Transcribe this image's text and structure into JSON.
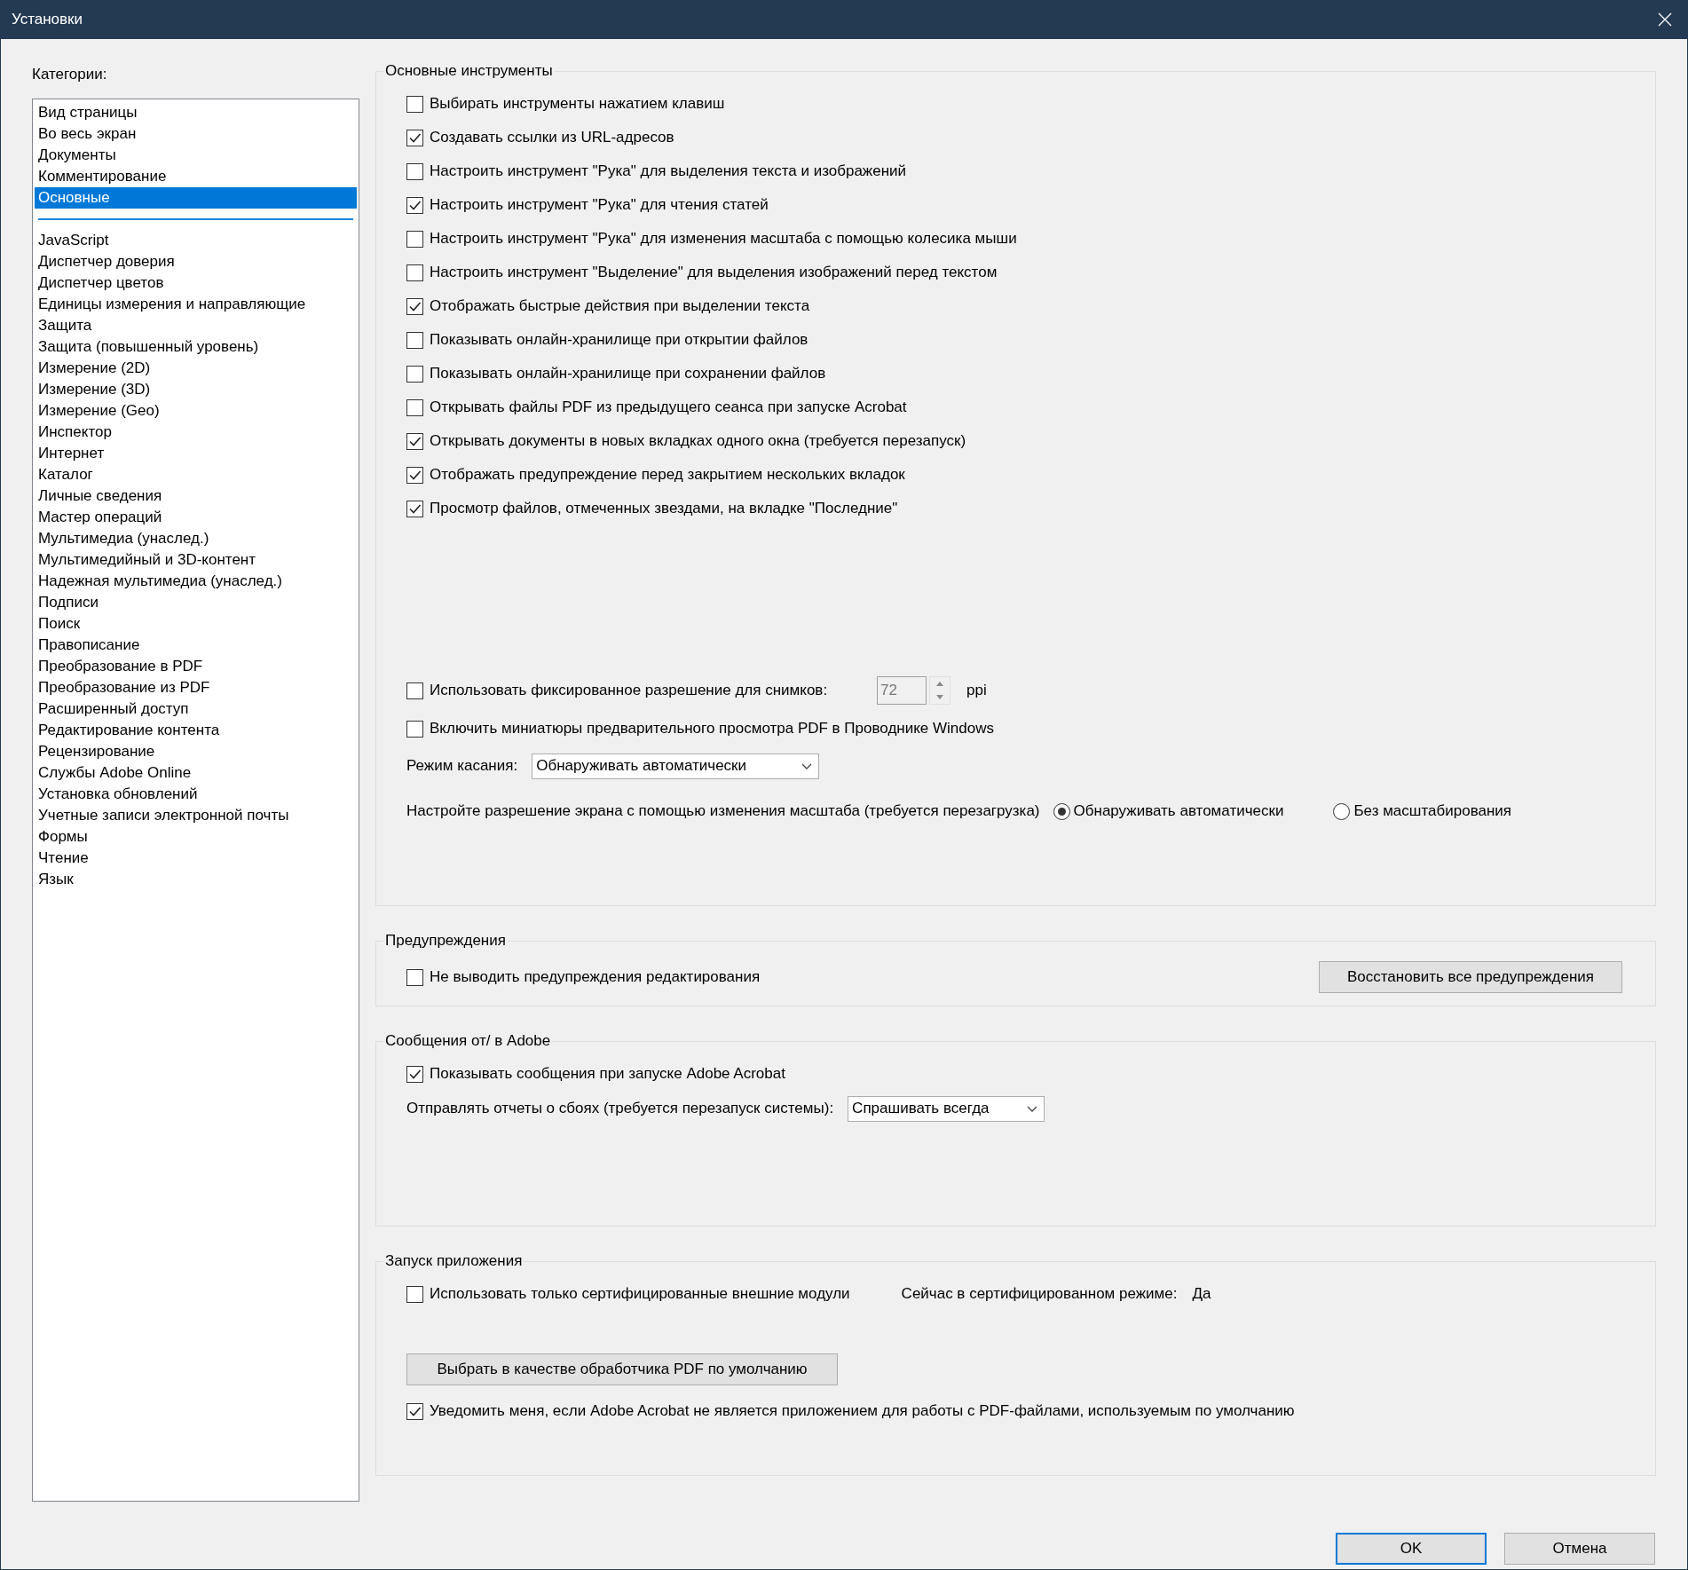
{
  "window": {
    "title": "Установки"
  },
  "categories": {
    "label": "Категории:",
    "pinned_items": [
      {
        "label": "Вид страницы",
        "selected": false
      },
      {
        "label": "Во весь экран",
        "selected": false
      },
      {
        "label": "Документы",
        "selected": false
      },
      {
        "label": "Комментирование",
        "selected": false
      },
      {
        "label": "Основные",
        "selected": true
      }
    ],
    "items": [
      {
        "label": "JavaScript",
        "selected": false
      },
      {
        "label": "Диспетчер доверия",
        "selected": false
      },
      {
        "label": "Диспетчер цветов",
        "selected": false
      },
      {
        "label": "Единицы измерения и направляющие",
        "selected": false
      },
      {
        "label": "Защита",
        "selected": false
      },
      {
        "label": "Защита (повышенный уровень)",
        "selected": false
      },
      {
        "label": "Измерение (2D)",
        "selected": false
      },
      {
        "label": "Измерение (3D)",
        "selected": false
      },
      {
        "label": "Измерение (Geo)",
        "selected": false
      },
      {
        "label": "Инспектор",
        "selected": false
      },
      {
        "label": "Интернет",
        "selected": false
      },
      {
        "label": "Каталог",
        "selected": false
      },
      {
        "label": "Личные сведения",
        "selected": false
      },
      {
        "label": "Мастер операций",
        "selected": false
      },
      {
        "label": "Мультимедиа (унаслед.)",
        "selected": false
      },
      {
        "label": "Мультимедийный и 3D-контент",
        "selected": false
      },
      {
        "label": "Надежная мультимедиа (унаслед.)",
        "selected": false
      },
      {
        "label": "Подписи",
        "selected": false
      },
      {
        "label": "Поиск",
        "selected": false
      },
      {
        "label": "Правописание",
        "selected": false
      },
      {
        "label": "Преобразование в PDF",
        "selected": false
      },
      {
        "label": "Преобразование из PDF",
        "selected": false
      },
      {
        "label": "Расширенный доступ",
        "selected": false
      },
      {
        "label": "Редактирование контента",
        "selected": false
      },
      {
        "label": "Рецензирование",
        "selected": false
      },
      {
        "label": "Службы Adobe Online",
        "selected": false
      },
      {
        "label": "Установка обновлений",
        "selected": false
      },
      {
        "label": "Учетные записи электронной почты",
        "selected": false
      },
      {
        "label": "Формы",
        "selected": false
      },
      {
        "label": "Чтение",
        "selected": false
      },
      {
        "label": "Язык",
        "selected": false
      }
    ]
  },
  "sections": [
    {
      "title": "Основные инструменты",
      "controls": [
        {
          "kind": "checkbox",
          "label": "Выбирать инструменты нажатием клавиш",
          "checked": false
        },
        {
          "kind": "checkbox",
          "label": "Создавать ссылки из URL-адресов",
          "checked": true
        },
        {
          "kind": "checkbox",
          "label": "Настроить инструмент \"Рука\" для выделения текста и изображений",
          "checked": false
        },
        {
          "kind": "checkbox",
          "label": "Настроить инструмент \"Рука\" для чтения статей",
          "checked": true
        },
        {
          "kind": "checkbox",
          "label": "Настроить инструмент \"Рука\" для изменения масштаба с помощью колесика мыши",
          "checked": false
        },
        {
          "kind": "checkbox",
          "label": "Настроить инструмент \"Выделение\" для выделения изображений перед текстом",
          "checked": false
        },
        {
          "kind": "checkbox",
          "label": "Отображать быстрые действия при выделении текста",
          "checked": true
        },
        {
          "kind": "checkbox",
          "label": "Показывать онлайн-хранилище при открытии файлов",
          "checked": false
        },
        {
          "kind": "checkbox",
          "label": "Показывать онлайн-хранилище при сохранении файлов",
          "checked": false
        },
        {
          "kind": "checkbox",
          "label": "Открывать файлы PDF из предыдущего сеанса при запуске Acrobat",
          "checked": false
        },
        {
          "kind": "checkbox",
          "label": "Открывать документы в новых вкладках одного окна (требуется перезапуск)",
          "checked": true
        },
        {
          "kind": "checkbox",
          "label": "Отображать предупреждение перед закрытием нескольких вкладок",
          "checked": true
        },
        {
          "kind": "checkbox",
          "label": "Просмотр файлов, отмеченных звездами, на вкладке \"Последние\"",
          "checked": true
        },
        {
          "kind": "spin",
          "label": "Использовать фиксированное разрешение для снимков:",
          "checked": false,
          "value": "72",
          "unit": "ppi"
        },
        {
          "kind": "checkbox",
          "label": "Включить миниатюры предварительного просмотра PDF в Проводнике Windows",
          "checked": false
        },
        {
          "kind": "select",
          "label": "Режим касания:",
          "value": "Обнаруживать автоматически"
        },
        {
          "kind": "radio_group",
          "label": "Настройте разрешение экрана с помощью изменения масштаба (требуется перезагрузка)",
          "options": [
            {
              "label": "Обнаруживать автоматически",
              "selected": true
            },
            {
              "label": "Без масштабирования",
              "selected": false
            }
          ]
        }
      ]
    },
    {
      "title": "Предупреждения",
      "controls": [
        {
          "kind": "checkbox_button",
          "label": "Не выводить предупреждения редактирования",
          "checked": false,
          "button": "Восстановить все предупреждения"
        }
      ]
    },
    {
      "title": "Сообщения от/ в Adobe",
      "controls": [
        {
          "kind": "checkbox",
          "label": "Показывать сообщения при запуске Adobe Acrobat",
          "checked": true
        },
        {
          "kind": "select",
          "label": "Отправлять отчеты о сбоях (требуется перезапуск системы):",
          "value": "Спрашивать всегда"
        }
      ]
    },
    {
      "title": "Запуск приложения",
      "controls": [
        {
          "kind": "checkbox_status",
          "label": "Использовать только сертифицированные внешние модули",
          "checked": false,
          "status_label": "Сейчас в сертифицированном режиме:",
          "status_value": "Да"
        },
        {
          "kind": "button",
          "label": "Выбрать в качестве обработчика PDF по умолчанию"
        },
        {
          "kind": "checkbox",
          "label": "Уведомить меня, если Adobe Acrobat не является приложением для работы с PDF-файлами, используемым по умолчанию",
          "checked": true
        }
      ]
    }
  ],
  "footer": {
    "buttons": [
      {
        "label": "OK",
        "default": true
      },
      {
        "label": "Отмена",
        "default": false
      }
    ]
  }
}
